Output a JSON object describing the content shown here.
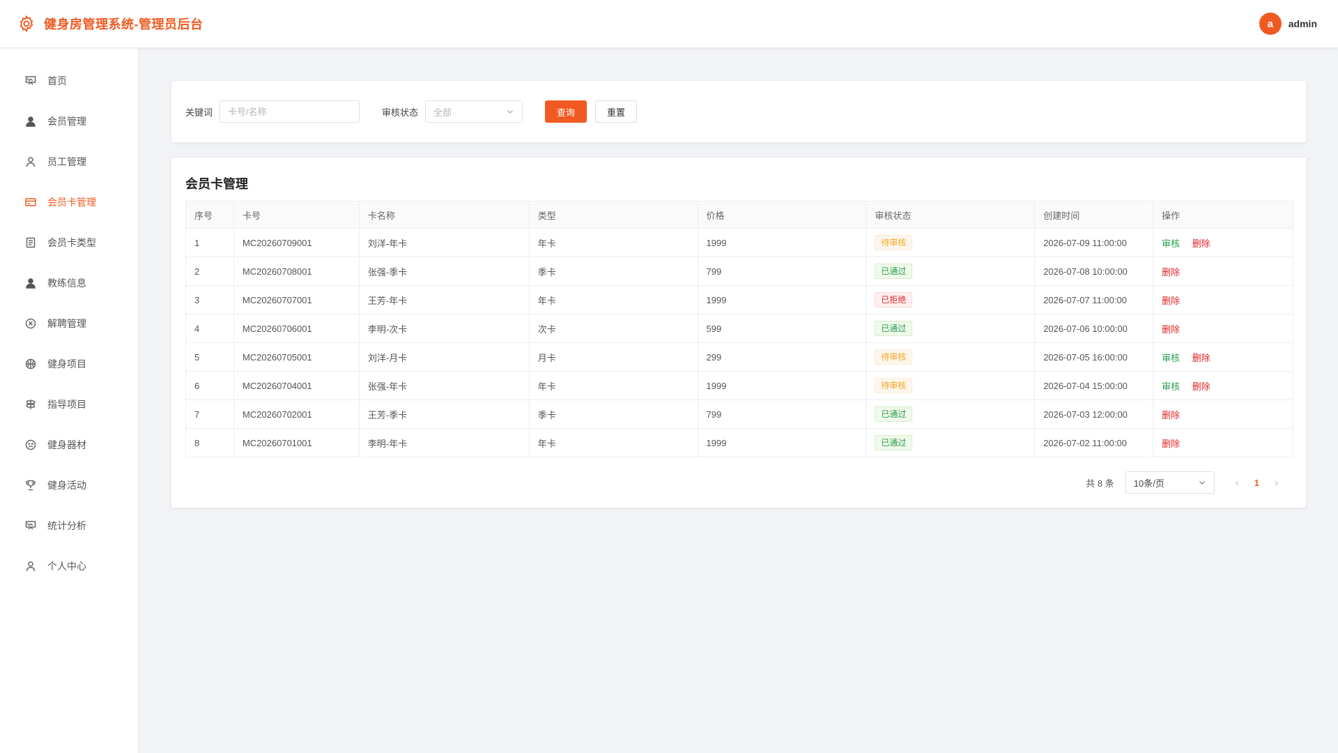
{
  "header": {
    "title": "健身房管理系统-管理员后台",
    "avatar_letter": "a",
    "username": "admin",
    "accent_color": "#f05a22"
  },
  "sidebar": {
    "items": [
      {
        "label": "首页",
        "icon": "presentation-board-icon",
        "active": false
      },
      {
        "label": "会员管理",
        "icon": "user-filled-icon",
        "active": false
      },
      {
        "label": "员工管理",
        "icon": "user-outline-icon",
        "active": false
      },
      {
        "label": "会员卡管理",
        "icon": "credit-card-icon",
        "active": true
      },
      {
        "label": "会员卡类型",
        "icon": "document-icon",
        "active": false
      },
      {
        "label": "教练信息",
        "icon": "user-filled-icon",
        "active": false
      },
      {
        "label": "解聘管理",
        "icon": "circle-x-icon",
        "active": false
      },
      {
        "label": "健身项目",
        "icon": "basketball-icon",
        "active": false
      },
      {
        "label": "指导项目",
        "icon": "signpost-icon",
        "active": false
      },
      {
        "label": "健身器材",
        "icon": "face-icon",
        "active": false
      },
      {
        "label": "健身活动",
        "icon": "trophy-icon",
        "active": false
      },
      {
        "label": "统计分析",
        "icon": "presentation-board-icon",
        "active": false
      },
      {
        "label": "个人中心",
        "icon": "user-outline-icon",
        "active": false
      }
    ]
  },
  "search": {
    "keyword_label": "关键词",
    "keyword_placeholder": "卡号/名称",
    "status_label": "审核状态",
    "status_value": "全部",
    "query_button": "查询",
    "reset_button": "重置"
  },
  "table": {
    "title": "会员卡管理",
    "columns": [
      "序号",
      "卡号",
      "卡名称",
      "类型",
      "价格",
      "审核状态",
      "创建时间",
      "操作"
    ],
    "rows": [
      {
        "index": "1",
        "card_no": "MC20260709001",
        "name": "刘洋-年卡",
        "type": "年卡",
        "price": "1999",
        "status": "待审核",
        "status_kind": "pending",
        "created": "2026-07-09 11:00:00",
        "actions": [
          "审核",
          "删除"
        ]
      },
      {
        "index": "2",
        "card_no": "MC20260708001",
        "name": "张强-季卡",
        "type": "季卡",
        "price": "799",
        "status": "已通过",
        "status_kind": "pass",
        "created": "2026-07-08 10:00:00",
        "actions": [
          "删除"
        ]
      },
      {
        "index": "3",
        "card_no": "MC20260707001",
        "name": "王芳-年卡",
        "type": "年卡",
        "price": "1999",
        "status": "已拒绝",
        "status_kind": "reject",
        "created": "2026-07-07 11:00:00",
        "actions": [
          "删除"
        ]
      },
      {
        "index": "4",
        "card_no": "MC20260706001",
        "name": "李明-次卡",
        "type": "次卡",
        "price": "599",
        "status": "已通过",
        "status_kind": "pass",
        "created": "2026-07-06 10:00:00",
        "actions": [
          "删除"
        ]
      },
      {
        "index": "5",
        "card_no": "MC20260705001",
        "name": "刘洋-月卡",
        "type": "月卡",
        "price": "299",
        "status": "待审核",
        "status_kind": "pending",
        "created": "2026-07-05 16:00:00",
        "actions": [
          "审核",
          "删除"
        ]
      },
      {
        "index": "6",
        "card_no": "MC20260704001",
        "name": "张强-年卡",
        "type": "年卡",
        "price": "1999",
        "status": "待审核",
        "status_kind": "pending",
        "created": "2026-07-04 15:00:00",
        "actions": [
          "审核",
          "删除"
        ]
      },
      {
        "index": "7",
        "card_no": "MC20260702001",
        "name": "王芳-季卡",
        "type": "季卡",
        "price": "799",
        "status": "已通过",
        "status_kind": "pass",
        "created": "2026-07-03 12:00:00",
        "actions": [
          "删除"
        ]
      },
      {
        "index": "8",
        "card_no": "MC20260701001",
        "name": "李明-年卡",
        "type": "年卡",
        "price": "1999",
        "status": "已通过",
        "status_kind": "pass",
        "created": "2026-07-02 11:00:00",
        "actions": [
          "删除"
        ]
      }
    ]
  },
  "pagination": {
    "total_text": "共 8 条",
    "page_size": "10条/页",
    "current_page": "1",
    "prev_icon": "chevron-left-icon",
    "next_icon": "chevron-right-icon"
  }
}
